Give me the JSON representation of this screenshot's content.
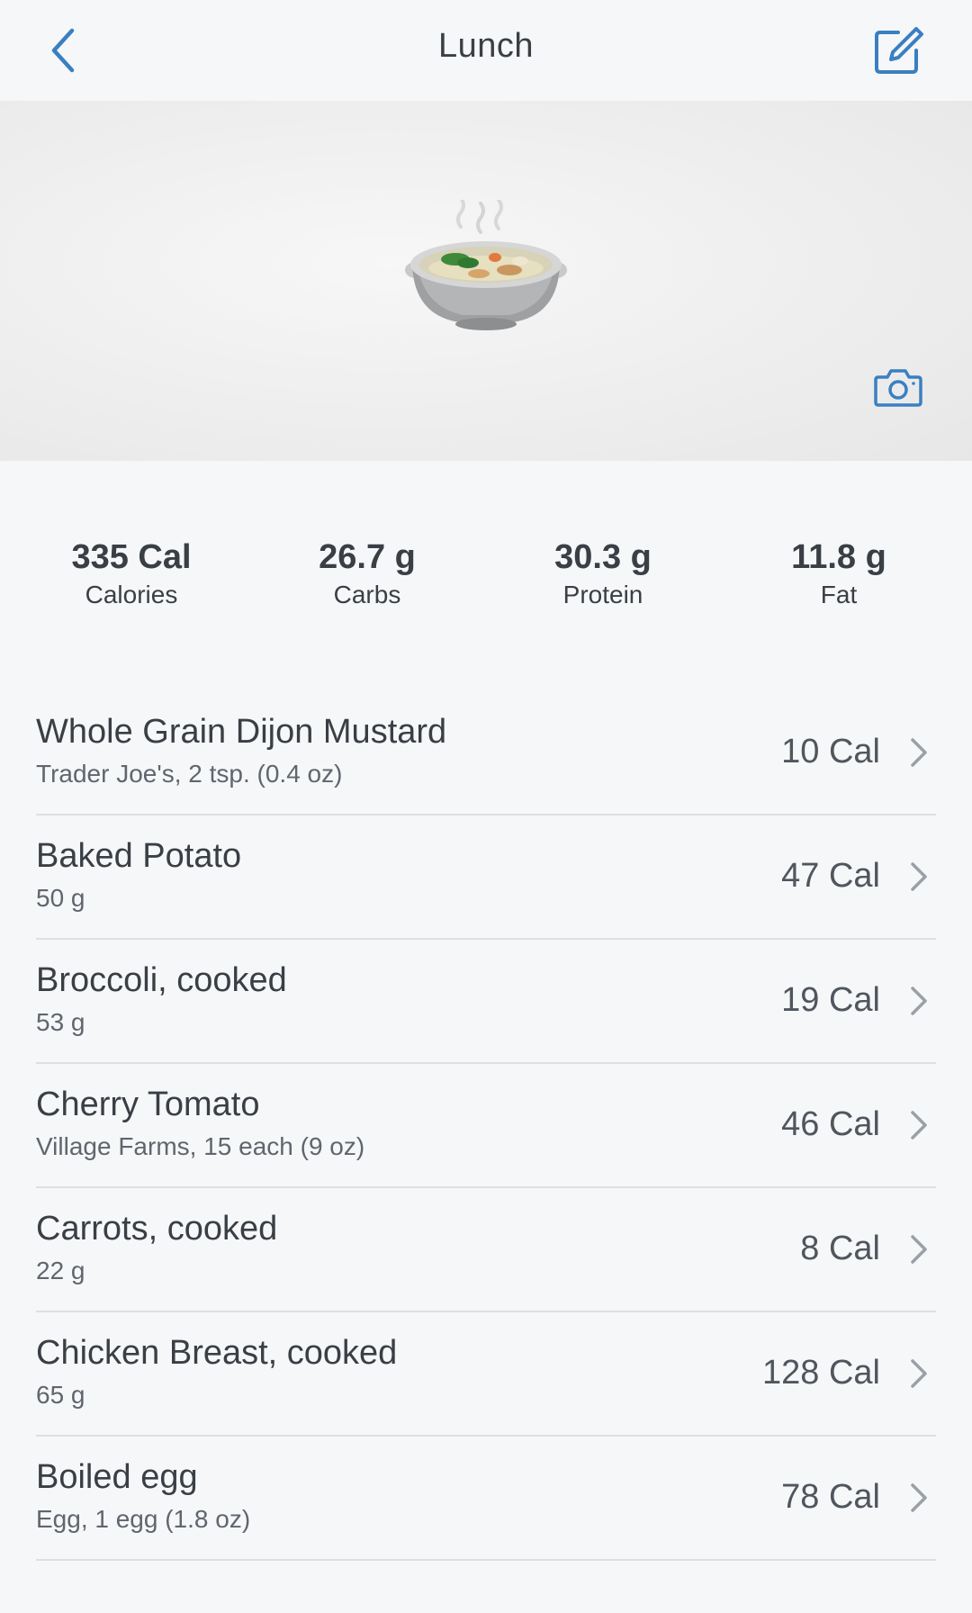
{
  "header": {
    "title": "Lunch",
    "back_icon": "chevron-left-icon",
    "edit_icon": "edit-square-icon"
  },
  "photo": {
    "image": "soup-bowl-emoji",
    "camera_icon": "camera-icon"
  },
  "macros": [
    {
      "value": "335 Cal",
      "label": "Calories"
    },
    {
      "value": "26.7 g",
      "label": "Carbs"
    },
    {
      "value": "30.3 g",
      "label": "Protein"
    },
    {
      "value": "11.8 g",
      "label": "Fat"
    }
  ],
  "foods": [
    {
      "name": "Whole Grain Dijon Mustard",
      "detail": "Trader Joe's, 2 tsp. (0.4 oz)",
      "calories": "10 Cal"
    },
    {
      "name": "Baked Potato",
      "detail": "50 g",
      "calories": "47 Cal"
    },
    {
      "name": "Broccoli, cooked",
      "detail": "53 g",
      "calories": "19 Cal"
    },
    {
      "name": "Cherry Tomato",
      "detail": "Village Farms, 15 each (9 oz)",
      "calories": "46 Cal"
    },
    {
      "name": "Carrots, cooked",
      "detail": "22 g",
      "calories": "8 Cal"
    },
    {
      "name": "Chicken Breast, cooked",
      "detail": "65 g",
      "calories": "128 Cal"
    },
    {
      "name": "Boiled egg",
      "detail": "Egg, 1 egg (1.8 oz)",
      "calories": "78 Cal"
    }
  ],
  "colors": {
    "accent": "#3a7fc1",
    "background": "#f6f7f9",
    "text": "#3a3f45",
    "divider": "#dcdfe3"
  }
}
